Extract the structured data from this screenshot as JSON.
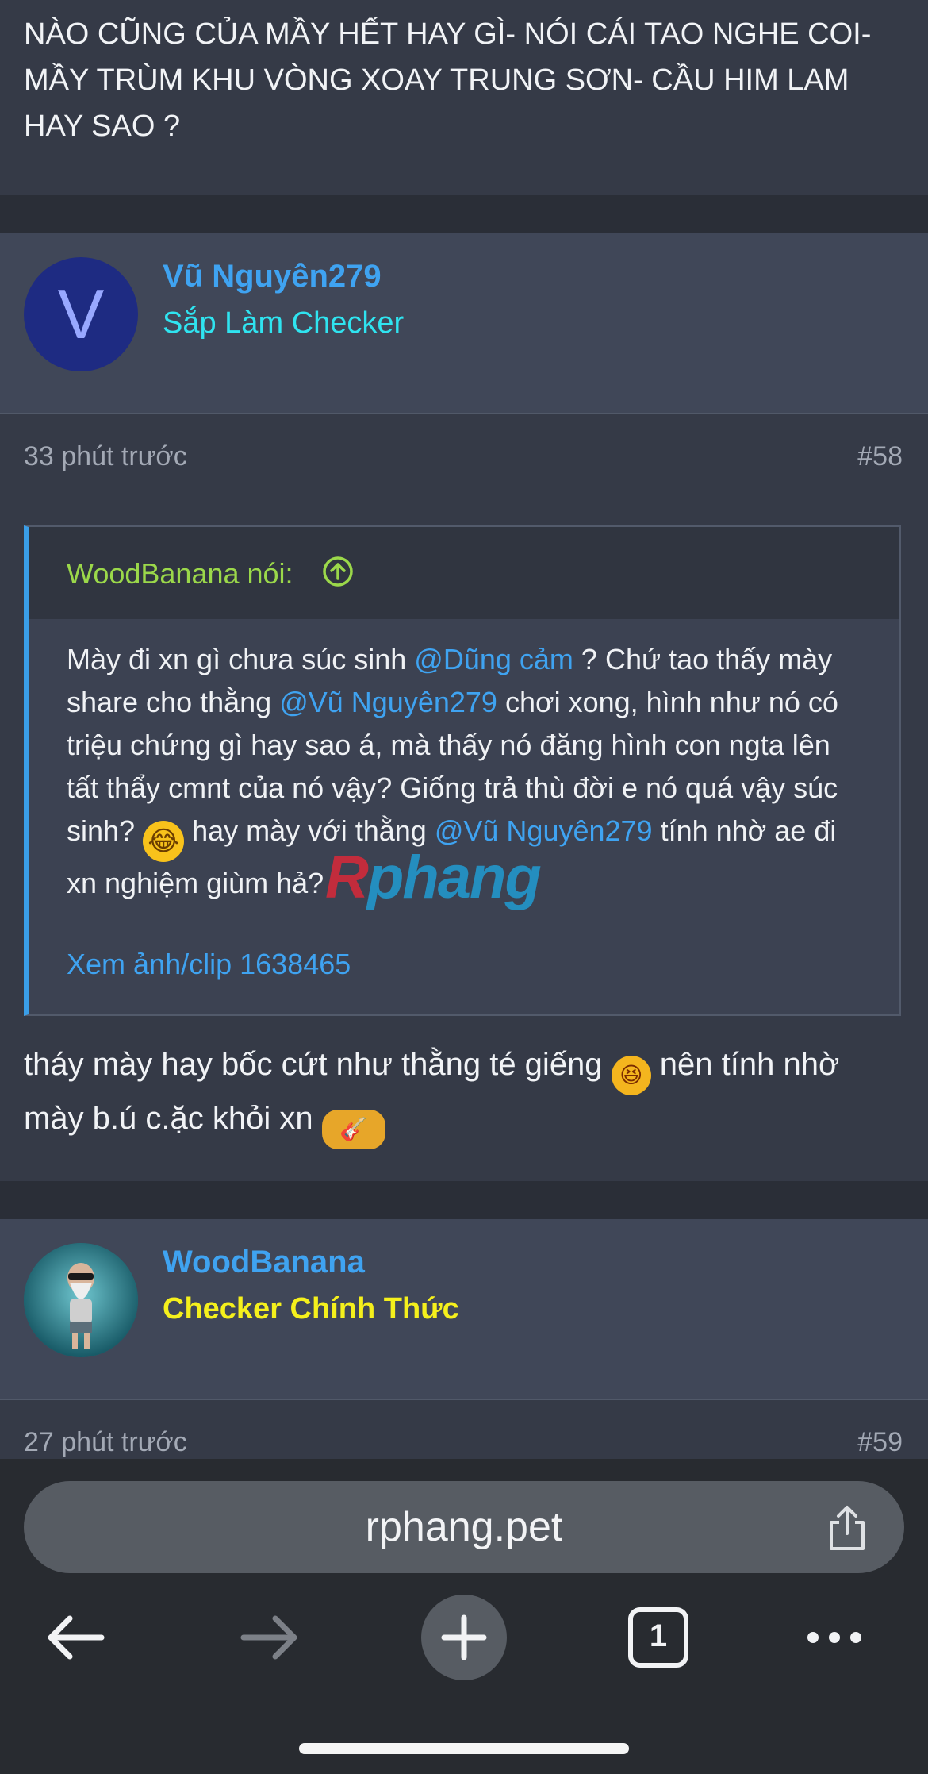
{
  "prev_post": {
    "text": "NÀO CŨNG CỦA MẦY HẾT HAY GÌ- NÓI CÁI TAO NGHE COI- MẦY TRÙM KHU VÒNG XOAY TRUNG SƠN- CẦU HIM LAM HAY SAO ?"
  },
  "post58": {
    "avatar_letter": "V",
    "author": "Vũ Nguyên279",
    "rank": "Sắp Làm Checker",
    "rank_color": "#2fe4f0",
    "time": "33 phút trước",
    "number": "#58",
    "quote": {
      "author_label": "WoodBanana nói:",
      "parts": {
        "t1": "Mày đi xn gì chưa súc sinh ",
        "m1": "@Dũng cảm",
        "t2": " ? Chứ tao thấy mày share cho thằng ",
        "m2": "@Vũ Nguyên279",
        "t3": " chơi xong, hình như nó có triệu chứng gì hay sao á, mà thấy nó đăng hình con ngta lên tất thẩy cmnt của nó vậy? Giống trả thù đời e nó quá vậy súc sinh? ",
        "t4": " hay mày với thằng ",
        "m3": "@Vũ Nguyên279",
        "t5": " tính nhờ ae đi xn nghiệm giùm hả?"
      },
      "view_link": "Xem ảnh/clip 1638465"
    },
    "reply": {
      "t1": "tháy mày hay bốc cứt như thằng té giếng ",
      "t2": " nên tính nhờ mày b.ú c.ặc khỏi xn "
    }
  },
  "watermark": {
    "part1": "R",
    "part2": "phang"
  },
  "post59": {
    "author": "WoodBanana",
    "rank": "Checker Chính Thức",
    "rank_color": "#f5f01c",
    "time": "27 phút trước",
    "number": "#59"
  },
  "browser": {
    "url": "rphang.pet",
    "tab_count": "1",
    "icons": [
      "back-arrow-icon",
      "forward-arrow-icon",
      "new-tab-plus-icon",
      "tabs-icon",
      "more-icon",
      "share-icon"
    ]
  }
}
